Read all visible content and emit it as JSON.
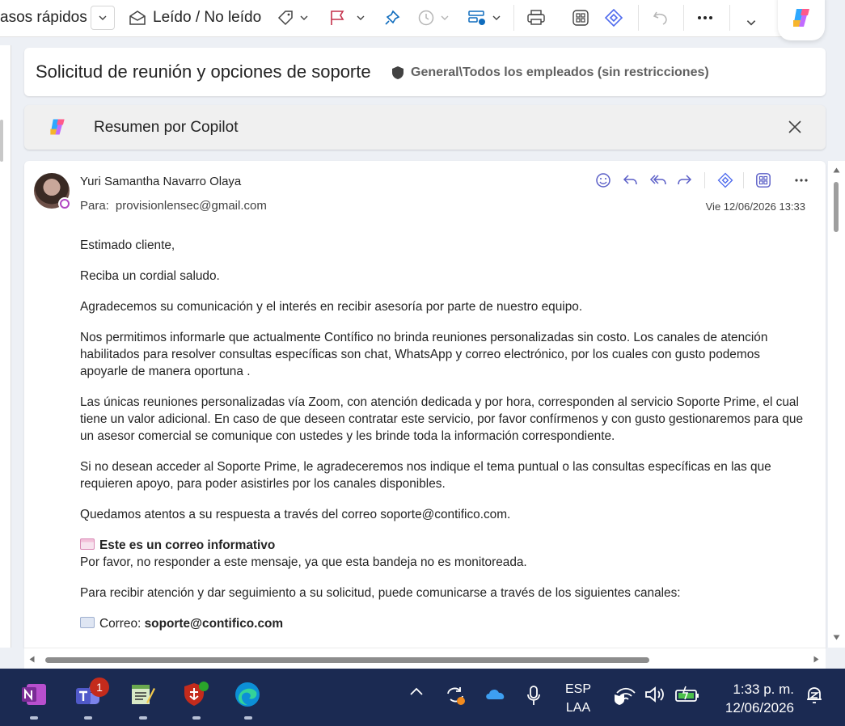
{
  "toolbar": {
    "quick_steps_label": "asos rápidos",
    "read_unread_label": "Leído / No leído"
  },
  "subject": {
    "title": "Solicitud de reunión y opciones de soporte",
    "sensitivity_label": "General\\Todos los empleados (sin restricciones)"
  },
  "copilot": {
    "summary_label": "Resumen por Copilot"
  },
  "message": {
    "sender": "Yuri Samantha Navarro Olaya",
    "to_label": "Para:",
    "to_address": "provisionlensec@gmail.com",
    "date": "Vie 12/06/2026 13:33",
    "body": {
      "greeting": "Estimado cliente,",
      "salutation": "Reciba un cordial saludo.",
      "p1": "Agradecemos su comunicación y el interés en recibir asesoría por parte de nuestro equipo.",
      "p2": "Nos permitimos informarle que actualmente Contífico no brinda reuniones personalizadas sin costo. Los canales de atención habilitados para resolver consultas específicas son chat, WhatsApp y correo electrónico, por los cuales con gusto podemos apoyarle de manera oportuna .",
      "p3": "Las únicas reuniones personalizadas vía Zoom, con atención dedicada y por hora, corresponden al servicio Soporte Prime, el cual tiene un valor adicional. En caso de que deseen contratar este servicio, por favor confírmenos y con gusto gestionaremos para que un asesor comercial se comunique con ustedes y les brinde toda la información correspondiente.",
      "p4": "Si no desean acceder al Soporte Prime, le agradeceremos nos indique el tema puntual o las consultas específicas en las que requieren apoyo, para poder asistirles por los canales disponibles.",
      "p5": "Quedamos atentos a su respuesta a través del correo soporte@contifico.com.",
      "info_heading": "Este es un correo informativo",
      "info_text": "Por favor, no responder a este mensaje, ya que esta bandeja no es monitoreada.",
      "channels_intro": "Para recibir atención y dar seguimiento a su solicitud, puede comunicarse a través de los siguientes canales:",
      "email_channel_label": "Correo:",
      "email_channel_value": "soporte@contifico.com"
    }
  },
  "taskbar": {
    "teams_badge": "1",
    "lang_code": "ESP",
    "lang_layout": "LAA",
    "time": "1:33 p. m.",
    "date": "12/06/2026"
  },
  "colors": {
    "accent": "#5b5fc7",
    "taskbar": "#1b2a52",
    "flag": "#c4314b",
    "pin": "#0f6cbd"
  }
}
